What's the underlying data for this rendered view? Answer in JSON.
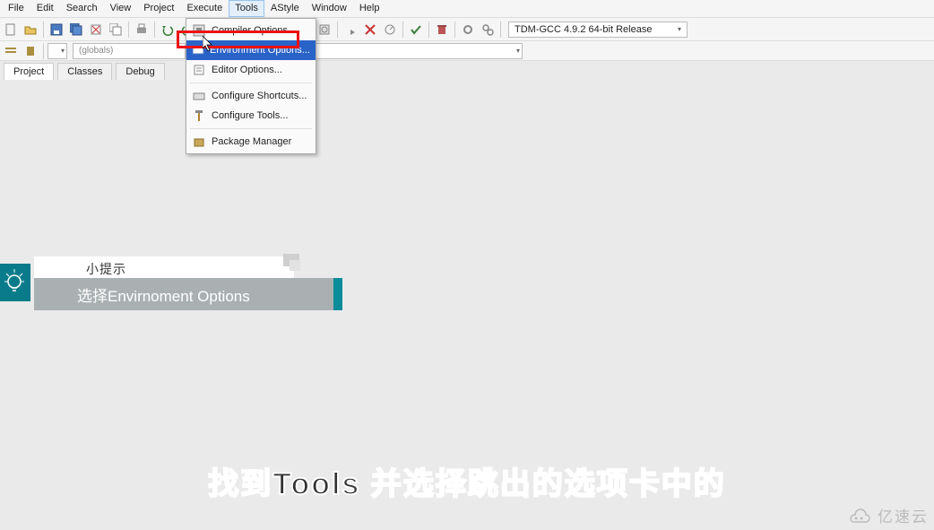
{
  "menubar": {
    "file": "File",
    "edit": "Edit",
    "search": "Search",
    "view": "View",
    "project": "Project",
    "execute": "Execute",
    "tools": "Tools",
    "astyle": "AStyle",
    "window": "Window",
    "help": "Help"
  },
  "toolbar_icons": {
    "new": "new-file-icon",
    "open": "open-icon",
    "save": "save-icon",
    "saveall": "save-all-icon",
    "print": "print-icon",
    "undo": "undo-icon",
    "redo": "redo-icon",
    "find": "find-icon",
    "replace": "replace-icon",
    "compile": "compile-icon",
    "run": "run-icon",
    "compile_run": "compile-run-icon",
    "rebuild": "rebuild-icon",
    "debug": "debug-icon",
    "stop": "stop-icon",
    "profile": "profile-icon",
    "check": "check-icon",
    "trash": "trash-icon",
    "gears1": "gears-icon",
    "gears2": "gears2-icon"
  },
  "compiler_selector": "TDM-GCC 4.9.2 64-bit Release",
  "globals_label": "(globals)",
  "tabs": {
    "project": "Project",
    "classes": "Classes",
    "debug": "Debug"
  },
  "tools_menu": {
    "compiler": "Compiler Options...",
    "environment": "Environment Options...",
    "editor": "Editor Options...",
    "shortcuts": "Configure Shortcuts...",
    "conftools": "Configure Tools...",
    "package": "Package Manager"
  },
  "tip": {
    "label": "小提示",
    "body": "选择Envirnoment Options"
  },
  "caption": "找到Tools 并选择跳出的选项卡中的",
  "watermark": "亿速云"
}
